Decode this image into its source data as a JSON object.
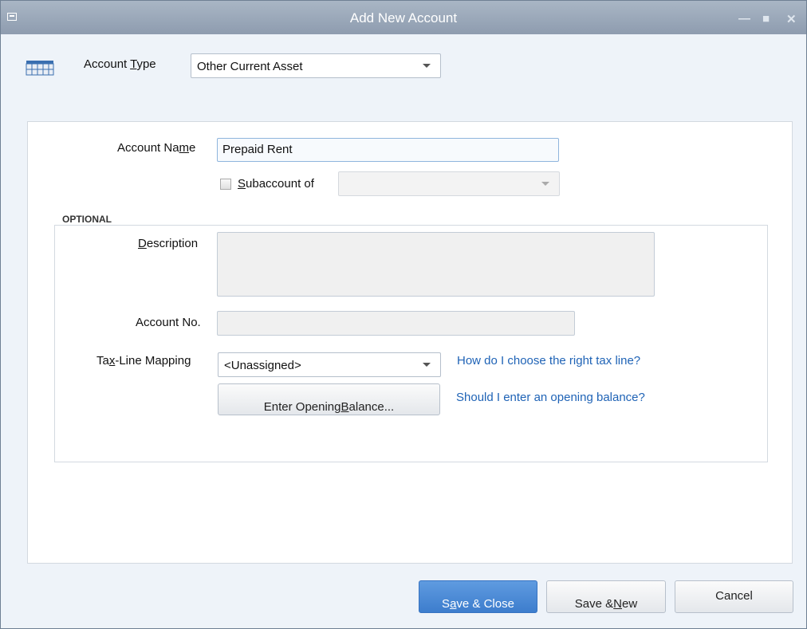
{
  "window": {
    "title": "Add New Account"
  },
  "account_type": {
    "label_pre": "Account ",
    "label_u": "T",
    "label_post": "ype",
    "value": "Other Current Asset"
  },
  "form": {
    "account_name_label_pre": "Account Na",
    "account_name_label_u": "m",
    "account_name_label_post": "e",
    "account_name_value": "Prepaid Rent",
    "subaccount_label_u": "S",
    "subaccount_label_post": "ubaccount of",
    "subaccount_value": ""
  },
  "optional": {
    "title": "OPTIONAL",
    "description_label_u": "D",
    "description_label_post": "escription",
    "description_value": "",
    "account_no_label": "Account No.",
    "account_no_value": "",
    "tax_line_label_pre": "Ta",
    "tax_line_label_u": "x",
    "tax_line_label_post": "-Line Mapping",
    "tax_line_value": "<Unassigned>",
    "tax_line_help": "How do I choose the right tax line?",
    "opening_balance_pre": "Enter Opening ",
    "opening_balance_u": "B",
    "opening_balance_post": "alance...",
    "opening_balance_help": "Should I enter an opening balance?"
  },
  "buttons": {
    "save_close_pre": "S",
    "save_close_u": "a",
    "save_close_post": "ve & Close",
    "save_new_pre": "Save & ",
    "save_new_u": "N",
    "save_new_post": "ew",
    "cancel": "Cancel"
  },
  "colors": {
    "primary": "#3d7dcd",
    "link": "#1f63b6"
  }
}
